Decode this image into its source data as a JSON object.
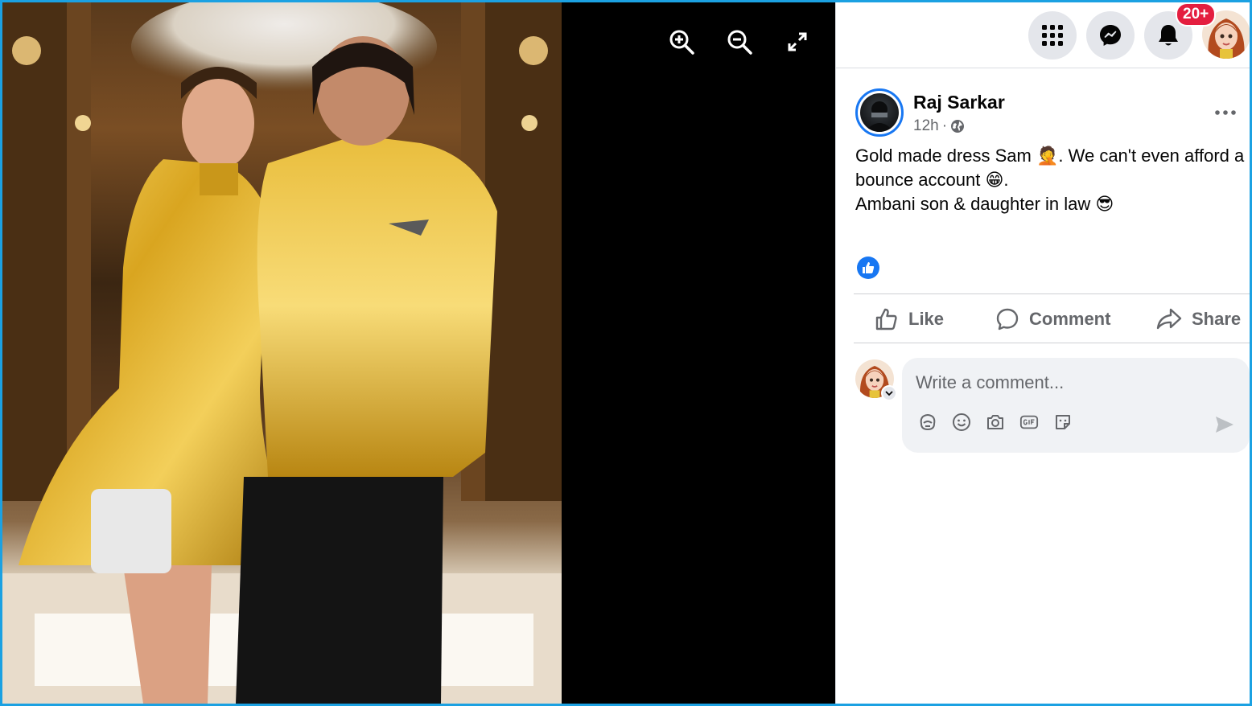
{
  "viewer": {
    "tools": [
      "zoom-in-icon",
      "zoom-out-icon",
      "fullscreen-icon"
    ]
  },
  "topbar": {
    "notification_badge": "20+"
  },
  "post": {
    "author_name": "Raj Sarkar",
    "time": "12h",
    "privacy_icon": "globe-icon",
    "text_lines": [
      "Gold made dress Sam 🤦. We can't even afford a",
      "bounce account 😁.",
      "Ambani son & daughter in law 😎"
    ],
    "reaction_icon": "like-reaction-icon"
  },
  "actions": {
    "like": "Like",
    "comment": "Comment",
    "share": "Share"
  },
  "comment_box": {
    "placeholder": "Write a comment...",
    "tools": [
      "avatar-sticker-icon",
      "emoji-icon",
      "camera-icon",
      "gif-icon",
      "sticker-icon"
    ]
  },
  "colors": {
    "accent": "#1877f2",
    "badge": "#e41e3f",
    "frame": "#1ba1e2"
  }
}
